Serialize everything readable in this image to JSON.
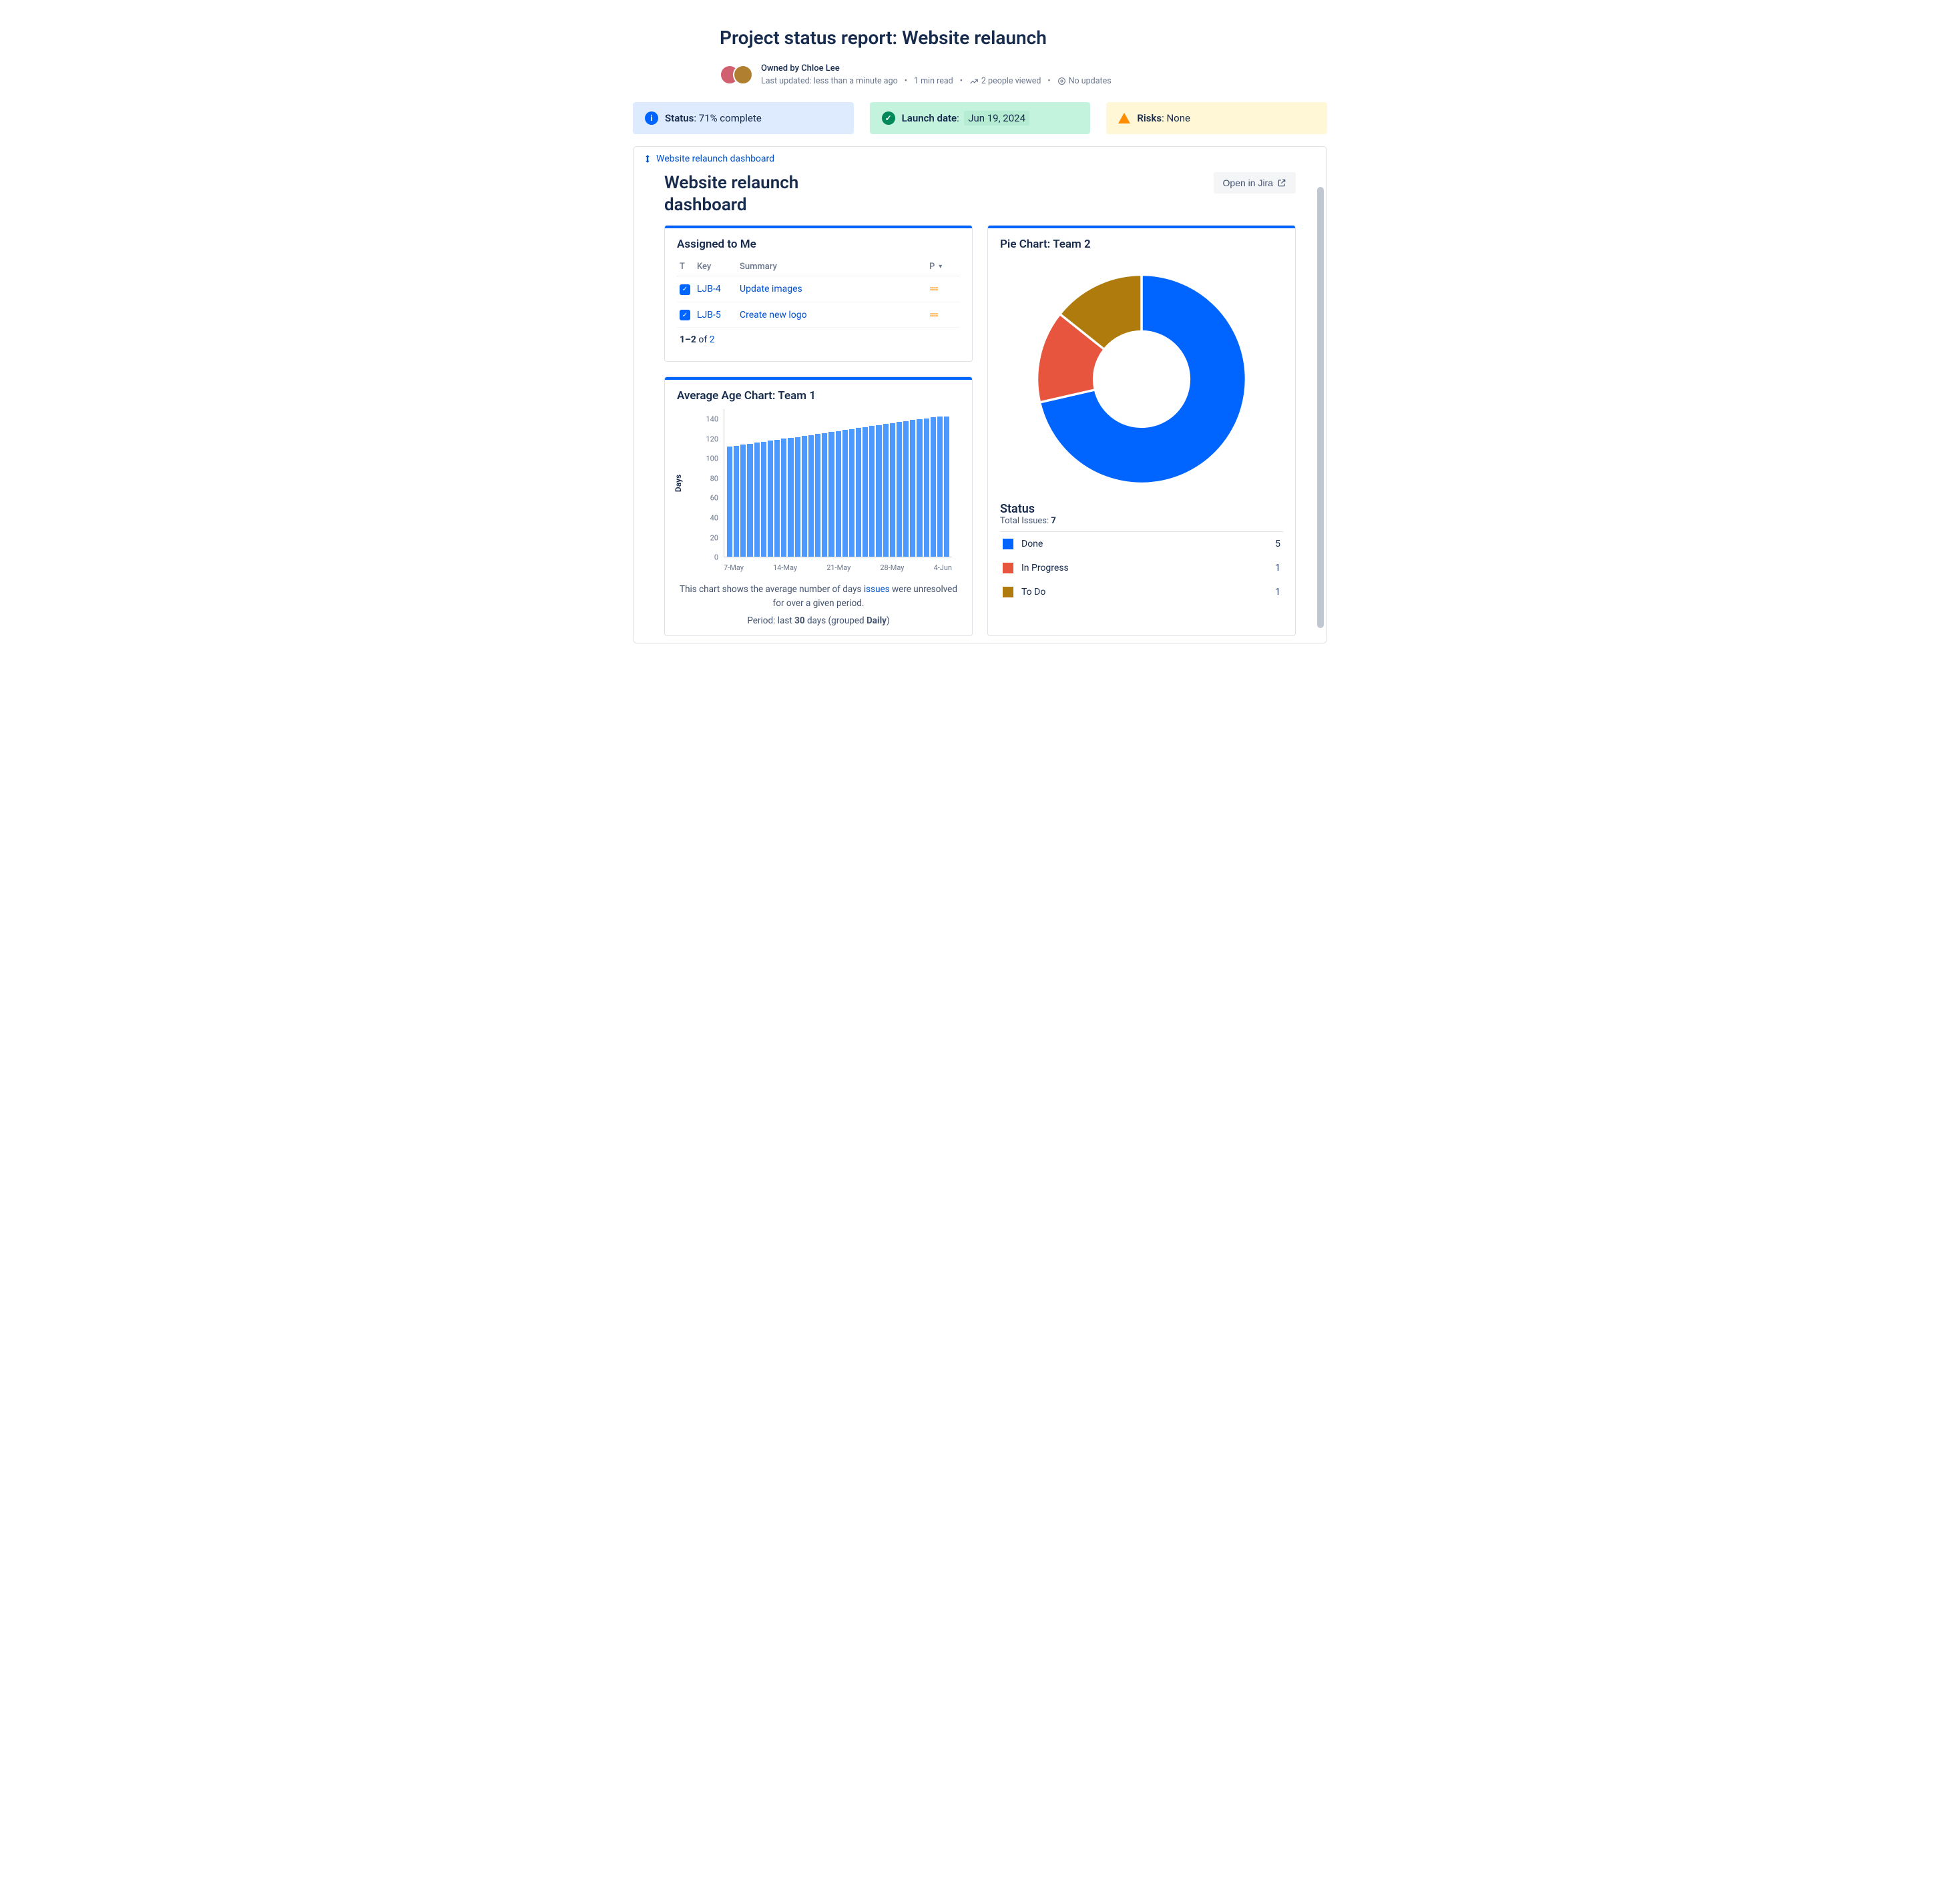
{
  "page": {
    "title": "Project status report: Website relaunch",
    "owner_line": "Owned by Chloe Lee",
    "last_updated": "Last updated: less than a minute ago",
    "read_time": "1 min read",
    "views": "2 people viewed",
    "updates": "No updates"
  },
  "cards": {
    "status": {
      "label": "Status",
      "value": "71% complete"
    },
    "launch": {
      "label": "Launch date",
      "value": "Jun 19, 2024"
    },
    "risks": {
      "label": "Risks",
      "value": "None"
    }
  },
  "dashboard": {
    "link_text": "Website relaunch dashboard",
    "title": "Website relaunch dashboard",
    "open_button": "Open in Jira"
  },
  "assigned": {
    "title": "Assigned to Me",
    "cols": {
      "t": "T",
      "key": "Key",
      "summary": "Summary",
      "p": "P"
    },
    "rows": [
      {
        "key": "LJB-4",
        "summary": "Update images"
      },
      {
        "key": "LJB-5",
        "summary": "Create new logo"
      }
    ],
    "pager_prefix": "1–2",
    "pager_of": " of ",
    "pager_total": "2"
  },
  "age_chart": {
    "title": "Average Age Chart: Team 1",
    "desc_1": "This chart shows the average number of days ",
    "desc_link": "issues",
    "desc_2": " were unresolved for over a given period.",
    "period_prefix": "Period: last ",
    "period_days": "30",
    "period_mid": " days (grouped ",
    "period_group": "Daily",
    "period_suffix": ")"
  },
  "pie": {
    "title": "Pie Chart: Team 2",
    "status_label": "Status",
    "total_label": "Total Issues: ",
    "total_value": "7",
    "legend": [
      {
        "name": "Done",
        "count": 5,
        "color": "#0065FF"
      },
      {
        "name": "In Progress",
        "count": 1,
        "color": "#E8553F"
      },
      {
        "name": "To Do",
        "count": 1,
        "color": "#B07B0D"
      }
    ]
  },
  "chart_data": [
    {
      "type": "bar",
      "title": "Average Age Chart: Team 1",
      "ylabel": "Days",
      "ylim": [
        0,
        150
      ],
      "yticks": [
        0,
        20,
        40,
        60,
        80,
        100,
        120,
        140
      ],
      "xticks": [
        "7-May",
        "14-May",
        "21-May",
        "28-May",
        "4-Jun"
      ],
      "categories": [
        "3-May",
        "4-May",
        "5-May",
        "6-May",
        "7-May",
        "8-May",
        "9-May",
        "10-May",
        "11-May",
        "12-May",
        "13-May",
        "14-May",
        "15-May",
        "16-May",
        "17-May",
        "18-May",
        "19-May",
        "20-May",
        "21-May",
        "22-May",
        "23-May",
        "24-May",
        "25-May",
        "26-May",
        "27-May",
        "28-May",
        "29-May",
        "30-May",
        "31-May",
        "1-Jun",
        "2-Jun",
        "3-Jun",
        "4-Jun"
      ],
      "values": [
        112,
        113,
        114,
        115,
        116,
        117,
        118,
        119,
        120,
        121,
        122,
        123,
        124,
        125,
        126,
        127,
        128,
        129,
        130,
        131,
        132,
        133,
        134,
        135,
        136,
        137,
        138,
        139,
        140,
        141,
        142,
        143,
        143
      ]
    },
    {
      "type": "pie",
      "title": "Pie Chart: Team 2",
      "series": [
        {
          "name": "Done",
          "value": 5,
          "color": "#0065FF"
        },
        {
          "name": "In Progress",
          "value": 1,
          "color": "#E8553F"
        },
        {
          "name": "To Do",
          "value": 1,
          "color": "#B07B0D"
        }
      ],
      "total": 7
    }
  ]
}
